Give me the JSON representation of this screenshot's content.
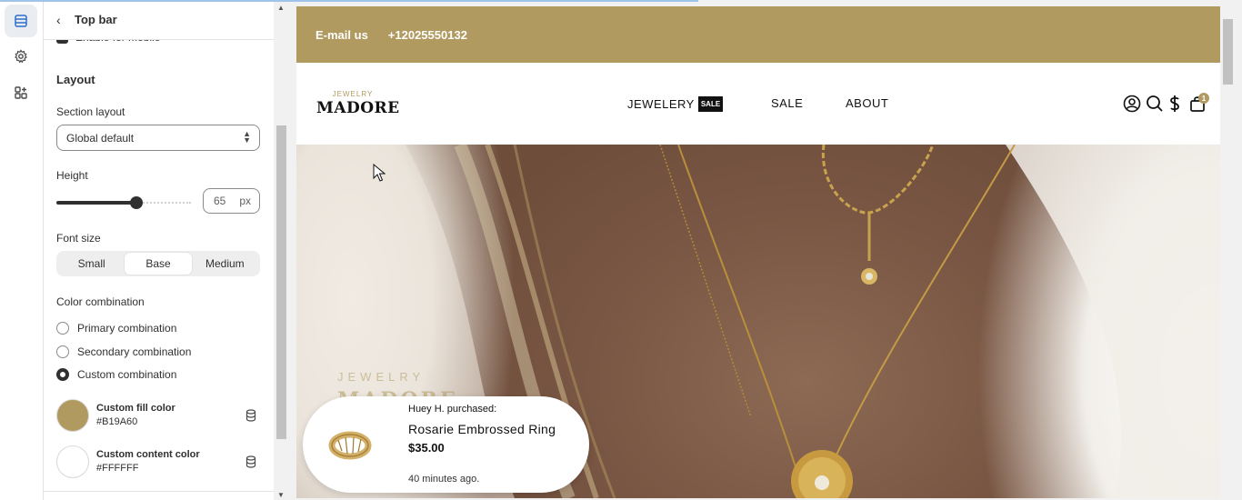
{
  "panel": {
    "back_icon": "chevron-left-icon",
    "title": "Top bar",
    "cutoff_label": "Enable for mobile",
    "section_title": "Layout",
    "section_layout": {
      "label": "Section layout",
      "value": "Global default"
    },
    "height": {
      "label": "Height",
      "value": "65",
      "unit": "px",
      "level": 0.58
    },
    "font_size": {
      "label": "Font size",
      "options": [
        "Small",
        "Base",
        "Medium"
      ],
      "selected": "Base"
    },
    "color_combination": {
      "label": "Color combination",
      "options": [
        "Primary combination",
        "Secondary combination",
        "Custom combination"
      ],
      "selected": "Custom combination"
    },
    "fill_color": {
      "name": "Custom fill color",
      "hex": "#B19A60"
    },
    "content_color": {
      "name": "Custom content color",
      "hex": "#FFFFFF"
    }
  },
  "rail": {
    "items": [
      "sections-icon",
      "settings-gear-icon",
      "apps-icon"
    ],
    "active": "sections-icon"
  },
  "preview": {
    "announcement": {
      "email": "E-mail us",
      "phone": "+12025550132",
      "bg": "#B19A60"
    },
    "logo": {
      "small": "JEWELRY",
      "big": "MADORE"
    },
    "nav": [
      {
        "label": "JEWELERY",
        "badge": "SALE"
      },
      {
        "label": "SALE"
      },
      {
        "label": "ABOUT"
      }
    ],
    "icons": [
      "account-icon",
      "search-icon",
      "currency-dollar-icon",
      "cart-icon"
    ],
    "cart_count": "1",
    "hero_overlay": {
      "small": "JEWELRY",
      "big": "MADORE"
    },
    "purchase_popup": {
      "who": "Huey H. purchased:",
      "product": "Rosarie Embrossed Ring",
      "price": "$35.00",
      "time": "40 minutes ago."
    }
  }
}
